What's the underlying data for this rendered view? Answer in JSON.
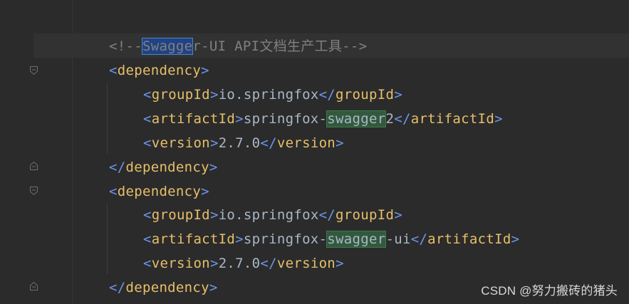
{
  "editor": {
    "lines": [
      {
        "kind": "comment",
        "prefix": "<!--",
        "highlight": "Swagge",
        "suffix": "r-UI API文档生产工具-->"
      },
      {
        "kind": "open",
        "tag": "dependency"
      },
      {
        "kind": "element",
        "tag": "groupId",
        "value_before": "io.springfox",
        "value_hl": "",
        "value_after": ""
      },
      {
        "kind": "element",
        "tag": "artifactId",
        "value_before": "springfox-",
        "value_hl": "swagger",
        "value_after": "2"
      },
      {
        "kind": "element",
        "tag": "version",
        "value_before": "2.7.0",
        "value_hl": "",
        "value_after": ""
      },
      {
        "kind": "close",
        "tag": "dependency"
      },
      {
        "kind": "open",
        "tag": "dependency"
      },
      {
        "kind": "element",
        "tag": "groupId",
        "value_before": "io.springfox",
        "value_hl": "",
        "value_after": ""
      },
      {
        "kind": "element",
        "tag": "artifactId",
        "value_before": "springfox-",
        "value_hl": "swagger",
        "value_after": "-ui"
      },
      {
        "kind": "element",
        "tag": "version",
        "value_before": "2.7.0",
        "value_hl": "",
        "value_after": ""
      },
      {
        "kind": "close",
        "tag": "dependency"
      }
    ]
  },
  "watermark": "CSDN @努力搬砖的猪头",
  "colors": {
    "background": "#2b2b2b",
    "tag": "#e8bf6a",
    "angle_bracket": "#6c95eb",
    "text": "#a9b7c6",
    "comment": "#808080",
    "caret_highlight": "#214283",
    "find_highlight": "#32593d"
  }
}
